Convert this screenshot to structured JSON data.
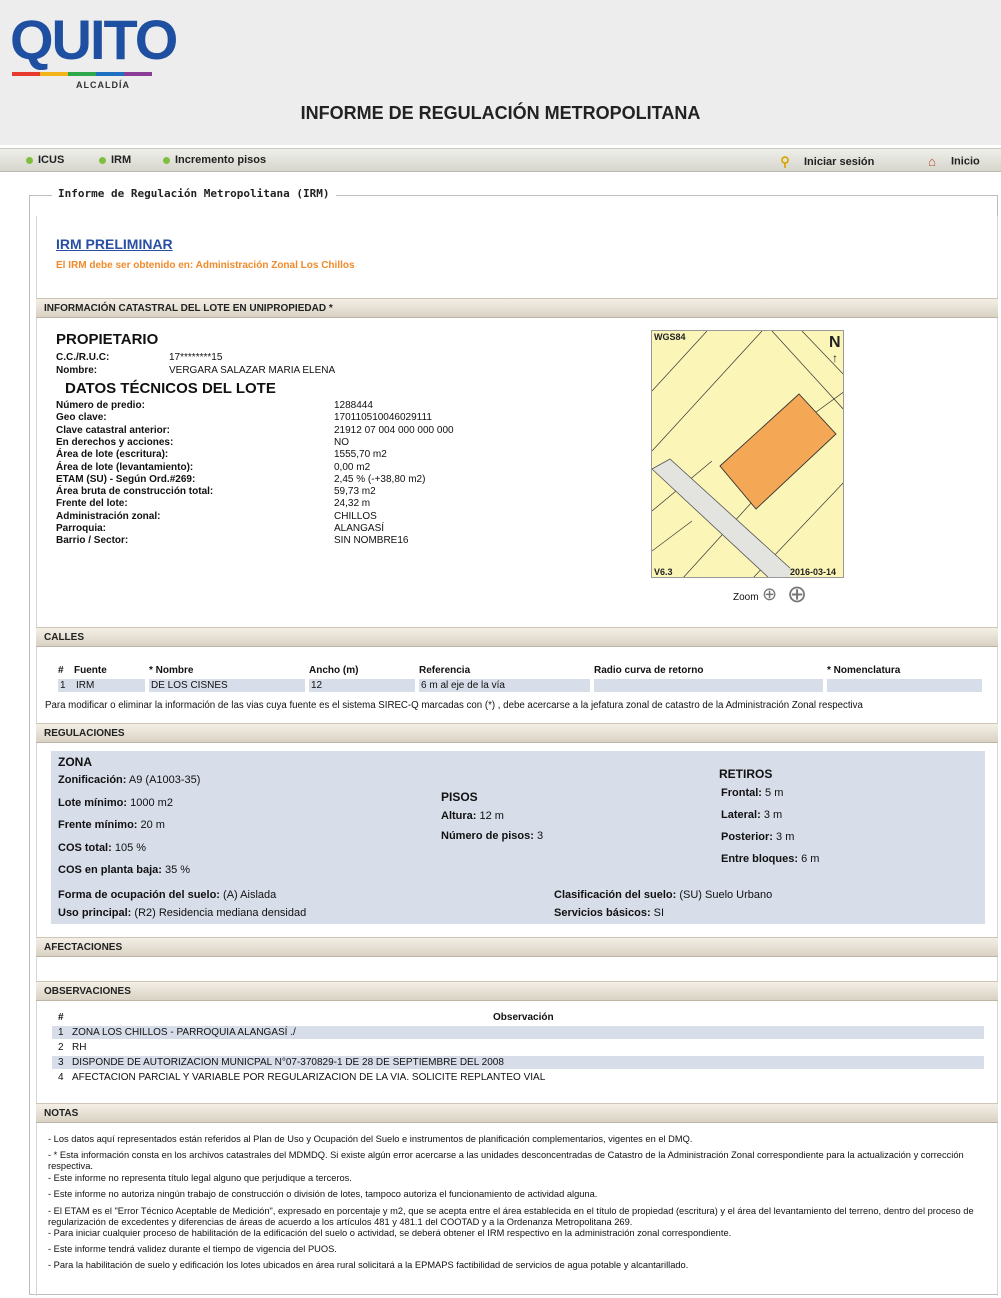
{
  "brand": {
    "word": "QUITO",
    "sub": "ALCALDÍA",
    "stripe_colors": [
      "#e63a2f",
      "#f3b31b",
      "#2ea64a",
      "#1f6fc1",
      "#8a3c97"
    ]
  },
  "report_title": "INFORME DE REGULACIÓN METROPOLITANA",
  "nav": {
    "items": [
      {
        "label": "ICUS"
      },
      {
        "label": "IRM"
      },
      {
        "label": "Incremento pisos"
      }
    ],
    "login": "Iniciar sesión",
    "home": "Inicio"
  },
  "legend": "Informe de Regulación Metropolitana (IRM)",
  "irm": {
    "link": "IRM PRELIMINAR",
    "note": "El IRM debe ser obtenido en: Administración Zonal Los Chillos"
  },
  "sections": {
    "catastral": "INFORMACIÓN CATASTRAL DEL LOTE EN UNIPROPIEDAD *",
    "calles": "CALLES",
    "regulaciones": "REGULACIONES",
    "afectaciones": "AFECTACIONES",
    "observaciones": "OBSERVACIONES",
    "notas": "NOTAS"
  },
  "propietario": {
    "heading": "PROPIETARIO",
    "ruc_label": "C.C./R.U.C:",
    "ruc": "17********15",
    "nombre_label": "Nombre:",
    "nombre": "VERGARA SALAZAR MARIA ELENA"
  },
  "datos": {
    "heading": "DATOS TÉCNICOS DEL LOTE",
    "rows": [
      {
        "label": "Número de predio:",
        "value": "1288444"
      },
      {
        "label": "Geo clave:",
        "value": "170110510046029111"
      },
      {
        "label": "Clave catastral anterior:",
        "value": "21912 07 004 000 000 000"
      },
      {
        "label": "En derechos y acciones:",
        "value": "NO"
      },
      {
        "label": "Área de lote (escritura):",
        "value": "1555,70 m2"
      },
      {
        "label": "Área de lote (levantamiento):",
        "value": "0,00 m2"
      },
      {
        "label": "ETAM (SU) - Según Ord.#269:",
        "value": "2,45 % (-+38,80 m2)"
      },
      {
        "label": "Área bruta de construcción total:",
        "value": "59,73 m2"
      },
      {
        "label": "Frente del lote:",
        "value": "24,32 m"
      },
      {
        "label": "Administración zonal:",
        "value": "CHILLOS"
      },
      {
        "label": "Parroquia:",
        "value": "ALANGASÍ"
      },
      {
        "label": "Barrio / Sector:",
        "value": "SIN NOMBRE16"
      }
    ]
  },
  "map": {
    "datum": "WGS84",
    "north": "N",
    "version": "V6.3",
    "date": "2016-03-14",
    "zoom_label": "Zoom",
    "lot_color": "#f4a755",
    "road_color": "#e3e3df",
    "bg_color": "#fbf6b8"
  },
  "calles": {
    "headers": [
      "#",
      "Fuente",
      "* Nombre",
      "Ancho (m)",
      "Referencia",
      "Radio curva de retorno",
      "* Nomenclatura"
    ],
    "rows": [
      [
        "1",
        "IRM",
        "DE LOS CISNES",
        "12",
        "6 m al eje de la vía",
        "",
        ""
      ]
    ],
    "note": "Para modificar o eliminar la información de las vias cuya fuente es el sistema SIREC-Q marcadas con (*) , debe acercarse a la jefatura zonal de catastro de la Administración Zonal respectiva"
  },
  "regulaciones": {
    "zona_heading": "ZONA",
    "zona": [
      {
        "label": "Zonificación:",
        "value": "A9 (A1003-35)"
      },
      {
        "label": "Lote mínimo:",
        "value": "1000 m2"
      },
      {
        "label": "Frente mínimo:",
        "value": "20 m"
      },
      {
        "label": "COS total:",
        "value": "105 %"
      },
      {
        "label": "COS en planta baja:",
        "value": "35 %"
      }
    ],
    "pisos_heading": "PISOS",
    "pisos": [
      {
        "label": "Altura:",
        "value": "12 m"
      },
      {
        "label": "Número de pisos:",
        "value": "3"
      }
    ],
    "retiros_heading": "RETIROS",
    "retiros": [
      {
        "label": "Frontal:",
        "value": "5 m"
      },
      {
        "label": "Lateral:",
        "value": "3 m"
      },
      {
        "label": "Posterior:",
        "value": "3 m"
      },
      {
        "label": "Entre bloques:",
        "value": "6 m"
      }
    ],
    "forma_label": "Forma de ocupación del suelo:",
    "forma": "(A) Aislada",
    "uso_label": "Uso principal:",
    "uso": "(R2) Residencia mediana densidad",
    "clasif_label": "Clasificación del suelo:",
    "clasif": "(SU) Suelo Urbano",
    "servicios_label": "Servicios básicos:",
    "servicios": "SI"
  },
  "observaciones": {
    "headers": [
      "#",
      "Observación"
    ],
    "rows": [
      [
        "1",
        "ZONA LOS CHILLOS - PARROQUIA ALANGASÍ ./"
      ],
      [
        "2",
        "RH"
      ],
      [
        "3",
        "DISPONDE DE AUTORIZACION MUNICPAL N°07-370829-1 DE 28 DE SEPTIEMBRE DEL 2008"
      ],
      [
        "4",
        "AFECTACION PARCIAL Y VARIABLE POR REGULARIZACION DE LA VIA. SOLICITE REPLANTEO VIAL"
      ]
    ]
  },
  "notas": [
    "- Los datos aquí representados están referidos al Plan de Uso y Ocupación del Suelo e instrumentos de planificación complementarios, vigentes en el DMQ.",
    "- * Esta información consta en los archivos catastrales del MDMDQ. Si existe algún error acercarse a las unidades desconcentradas de Catastro de la Administración Zonal correspondiente para la actualización y corrección respectiva.",
    "- Este informe no representa título legal alguno que perjudique a terceros.",
    "- Este informe no autoriza ningún trabajo de construcción o división de lotes, tampoco autoriza el funcionamiento de actividad alguna.",
    "- El ETAM es el \"Error Técnico Aceptable de Medición\", expresado en porcentaje y m2, que se acepta entre el área establecida en el título de propiedad (escritura) y el área del levantamiento del terreno, dentro del proceso de regularización de excedentes y diferencias de áreas de acuerdo a los artículos 481 y 481.1 del COOTAD y a la Ordenanza Metropolitana 269.",
    "- Para iniciar cualquier proceso de habilitación de la edificación del suelo o actividad, se deberá obtener el IRM respectivo en la administración zonal correspondiente.",
    "- Este informe tendrá validez durante el tiempo de vigencia del PUOS.",
    "- Para la habilitación de suelo y edificación los lotes ubicados en área rural solicitará a la EPMAPS factibilidad de servicios de agua potable y alcantarillado."
  ]
}
